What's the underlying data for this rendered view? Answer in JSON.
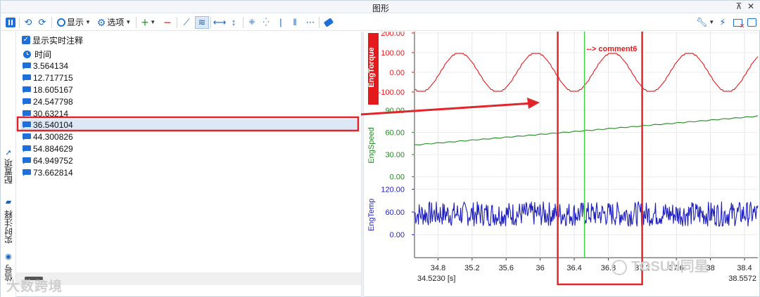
{
  "window": {
    "title": "图形",
    "pin_glyph": "⊼",
    "close_glyph": "✕"
  },
  "toolbar": {
    "display_label": "显示",
    "options_label": "选项",
    "icons": [
      "pause-icon",
      "undo-icon",
      "redo-icon",
      "display-icon",
      "options-gear-icon",
      "add-icon",
      "remove-icon",
      "line-chart-icon",
      "area-chart-icon",
      "fit-x-icon",
      "fit-y-icon",
      "shrink-x-icon",
      "expand-x-icon",
      "cursor-single-icon",
      "cursor-double-icon",
      "more-icon",
      "eraser-icon",
      "wrench-icon",
      "lightning-icon",
      "clear-window-icon",
      "export-icon"
    ]
  },
  "side_tabs": [
    "配置项",
    "实时注释",
    "信号"
  ],
  "panel": {
    "show_realtime_label": "显示实时注释",
    "time_header": "时间",
    "items": [
      "3.564134",
      "12.717715",
      "18.605167",
      "24.547798",
      "30.63214",
      "36.540104",
      "44.300826",
      "54.884629",
      "64.949752",
      "73.662814"
    ],
    "selected_index": 5
  },
  "watermarks": {
    "left": "大数跨境",
    "right": "TOSUN同星"
  },
  "chart_data": {
    "type": "line",
    "x_range": [
      34.523,
      38.5572
    ],
    "x_unit": "[s]",
    "x_ticks": [
      34.8,
      35.2,
      35.6,
      36,
      36.4,
      36.8,
      37.2,
      37.6,
      38,
      38.4
    ],
    "x_tick_labels": [
      "34.8",
      "35.2",
      "35.6",
      "36",
      "36.4",
      "36.8",
      "37.2",
      "37.6",
      "38",
      "38.4"
    ],
    "x_start_label": "34.5230 [s]",
    "x_end_label": "38.5572",
    "cursor_x": 36.52,
    "annotation": {
      "x": 36.52,
      "text": "--> comment6",
      "color": "#e41a1c"
    },
    "series": [
      {
        "name": "EngTorque",
        "color": "#e41a1c",
        "highlighted": true,
        "ylim": [
          -150,
          200
        ],
        "yticks": [
          200,
          100,
          0,
          -100
        ],
        "ytick_labels": [
          "200.00",
          "100.00",
          "0.00",
          "-100.00"
        ],
        "shape": "sine",
        "amplitude": 100,
        "period_s": 0.9,
        "phase_ref_x": 35.1,
        "peaks_x": [
          35.05,
          35.95,
          36.85,
          37.75
        ],
        "step": true
      },
      {
        "name": "EngSpeed",
        "color": "#228b22",
        "ylim": [
          -5,
          90
        ],
        "yticks": [
          90,
          60,
          30,
          0
        ],
        "ytick_labels": [
          "90.00",
          "60.00",
          "30.00",
          "0.00"
        ],
        "shape": "linear",
        "x": [
          34.523,
          38.5572
        ],
        "y": [
          43,
          82
        ]
      },
      {
        "name": "EngTemp",
        "color": "#1f1fbf",
        "ylim": [
          -20,
          125
        ],
        "yticks": [
          120,
          60,
          0
        ],
        "ytick_labels": [
          "120.00",
          "60.00",
          "0.00"
        ],
        "shape": "noise",
        "mean": 52,
        "range": [
          22,
          88
        ]
      }
    ]
  },
  "colors": {
    "accent": "#1e6fd9",
    "highlight": "#e0262b",
    "selected_row": "#dde8f6"
  }
}
